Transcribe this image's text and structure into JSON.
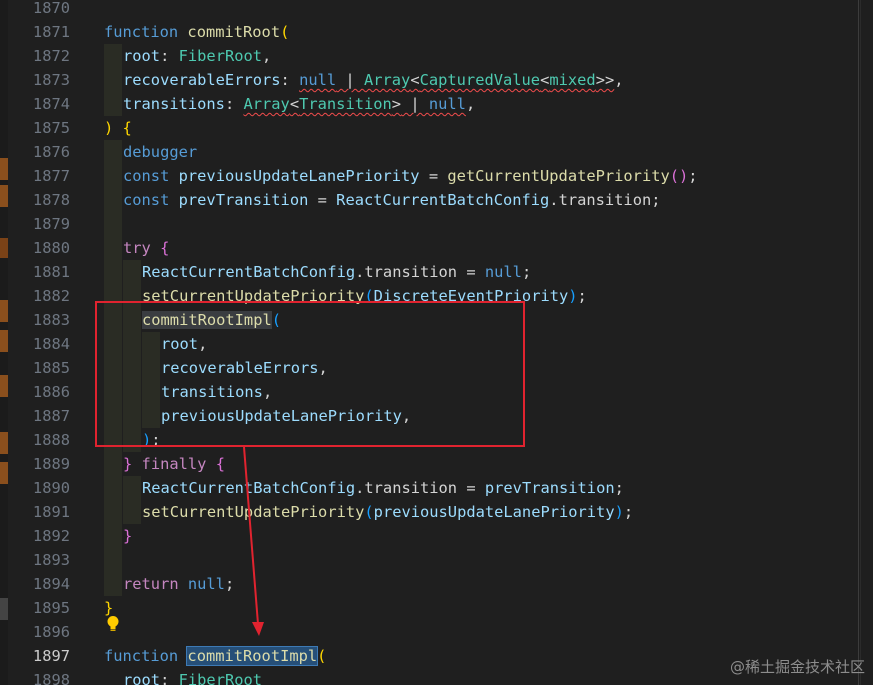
{
  "editor": {
    "language": "typescript",
    "active_line": 1897,
    "line_numbers": [
      "1870",
      "1871",
      "1872",
      "1873",
      "1874",
      "1875",
      "1876",
      "1877",
      "1878",
      "1879",
      "1880",
      "1881",
      "1882",
      "1883",
      "1884",
      "1885",
      "1886",
      "1887",
      "1888",
      "1889",
      "1890",
      "1891",
      "1892",
      "1893",
      "1894",
      "1895",
      "1896",
      "1897",
      "1898"
    ],
    "code": {
      "l1871": {
        "kw_function": "function",
        "fn_name": "commitRoot",
        "open_paren": "("
      },
      "l1872": {
        "param": "root",
        "colon": ": ",
        "type": "FiberRoot",
        "comma": ","
      },
      "l1873": {
        "param": "recoverableErrors",
        "colon": ": ",
        "null": "null",
        "pipe": " | ",
        "type_array": "Array",
        "lt": "<",
        "type_cv": "CapturedValue",
        "lt2": "<",
        "type_mixed": "mixed",
        "gt": ">>",
        "comma": ","
      },
      "l1874": {
        "param": "transitions",
        "colon": ": ",
        "type_array": "Array",
        "lt": "<",
        "type_tr": "Transition",
        "gt": ">",
        "pipe": " | ",
        "null": "null",
        "comma": ","
      },
      "l1875": {
        "close_paren": ")",
        "open_brace": " {"
      },
      "l1876": {
        "debugger": "debugger"
      },
      "l1877": {
        "kw_const": "const",
        "name": "previousUpdateLanePriority",
        "eq": " = ",
        "call": "getCurrentUpdatePriority",
        "parens": "()",
        "semi": ";"
      },
      "l1878": {
        "kw_const": "const",
        "name": "prevTransition",
        "eq": " = ",
        "obj": "ReactCurrentBatchConfig",
        "dot_prop": ".transition",
        "semi": ";"
      },
      "l1880": {
        "kw_try": "try",
        "brace": " {"
      },
      "l1881": {
        "obj": "ReactCurrentBatchConfig",
        "dot_prop": ".transition",
        "eq": " = ",
        "null": "null",
        "semi": ";"
      },
      "l1882": {
        "call": "setCurrentUpdatePriority",
        "open": "(",
        "arg": "DiscreteEventPriority",
        "close": ")",
        "semi": ";"
      },
      "l1883": {
        "call": "commitRootImpl",
        "open": "("
      },
      "l1884": {
        "arg": "root",
        "comma": ","
      },
      "l1885": {
        "arg": "recoverableErrors",
        "comma": ","
      },
      "l1886": {
        "arg": "transitions",
        "comma": ","
      },
      "l1887": {
        "arg": "previousUpdateLanePriority",
        "comma": ","
      },
      "l1888": {
        "close": ")",
        "semi": ";"
      },
      "l1889": {
        "close_brace": "}",
        "kw_finally": " finally",
        "brace": " {"
      },
      "l1890": {
        "obj": "ReactCurrentBatchConfig",
        "dot_prop": ".transition",
        "eq": " = ",
        "val": "prevTransition",
        "semi": ";"
      },
      "l1891": {
        "call": "setCurrentUpdatePriority",
        "open": "(",
        "arg": "previousUpdateLanePriority",
        "close": ")",
        "semi": ";"
      },
      "l1892": {
        "close_brace": "}"
      },
      "l1894": {
        "kw_return": "return",
        "null": " null",
        "semi": ";"
      },
      "l1895": {
        "close_brace": "}"
      },
      "l1897": {
        "kw_function": "function",
        "fn_name": "commitRootImpl",
        "open_paren": "("
      },
      "l1898": {
        "param": "root",
        "colon": ": ",
        "type": "FiberRoot"
      }
    }
  },
  "annotation": {
    "box_color": "#e0232f",
    "arrow_color": "#e0232f"
  },
  "icons": {
    "lightbulb": "lightbulb-icon"
  },
  "watermark": "@稀土掘金技术社区"
}
